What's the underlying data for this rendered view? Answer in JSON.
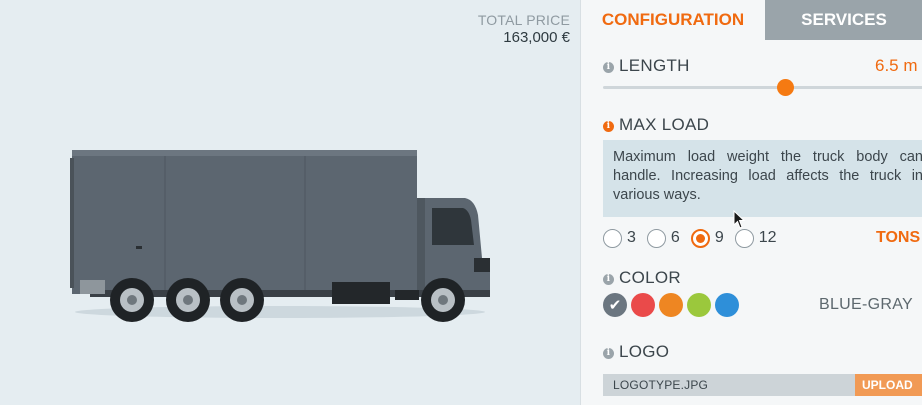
{
  "price": {
    "label": "TOTAL PRICE",
    "value": "163,000 €"
  },
  "tabs": [
    {
      "label": "CONFIGURATION",
      "active": true
    },
    {
      "label": "SERVICES",
      "active": false
    }
  ],
  "length": {
    "label": "LENGTH",
    "value": "6.5 m",
    "slider_fraction": 0.55
  },
  "max_load": {
    "label": "MAX LOAD",
    "description": "Maximum load weight the truck body can handle. Increasing load affects the truck in various ways.",
    "options": [
      "3",
      "6",
      "9",
      "12"
    ],
    "selected": "9",
    "unit": "TONS"
  },
  "color": {
    "label": "COLOR",
    "selected_name": "BLUE-GRAY",
    "swatches": [
      "#6b7680",
      "#ea4a4a",
      "#ee8622",
      "#9bc83c",
      "#2e8fd9"
    ],
    "selected_index": 0
  },
  "logo": {
    "label": "LOGO",
    "filename": "LOGOTYPE.JPG",
    "upload_label": "UPLOAD"
  },
  "colors": {
    "accent": "#f06a10",
    "tab_inactive": "#9aa4aa",
    "truck_body": "#5c6670"
  }
}
